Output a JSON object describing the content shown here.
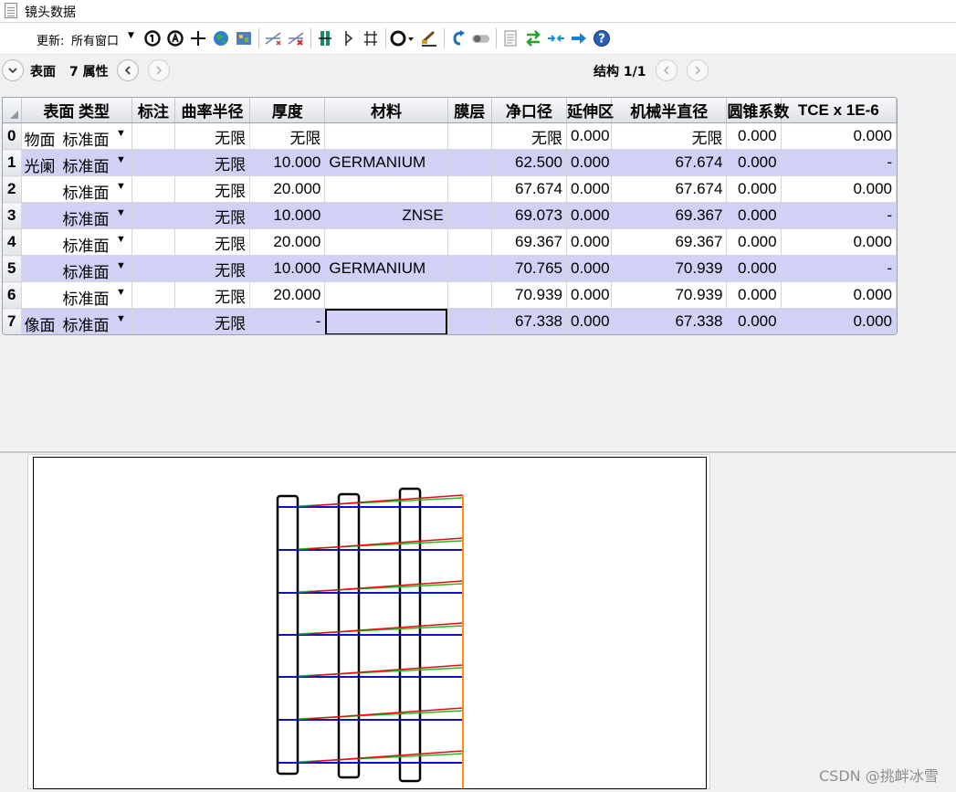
{
  "window": {
    "title": "镜头数据"
  },
  "toolbar": {
    "update_label": "更新:",
    "update_value": "所有窗口",
    "icons": [
      "refresh-all-icon",
      "refresh-icon",
      "crosshair-icon",
      "globe-icon",
      "map-icon",
      "add-fold-icon",
      "remove-fold-icon",
      "group-icon",
      "split-icon",
      "fold-icon",
      "circle-options-icon",
      "settings-brush-icon",
      "undo-arrow-icon",
      "toggle-icon",
      "page-icon",
      "swap-arrows-icon",
      "collapse-arrows-icon",
      "right-arrow-icon",
      "help-icon"
    ]
  },
  "nav": {
    "expand_icon": "chevron-down-icon",
    "left_label": "表面",
    "props_label": "7 属性",
    "config_label": "结构 1/1"
  },
  "grid": {
    "columns": [
      "表面 类型",
      "标注",
      "曲率半径",
      "厚度",
      "材料",
      "膜层",
      "净口径",
      "延伸区",
      "机械半直径",
      "圆锥系数",
      "TCE x 1E-6"
    ],
    "rows": [
      {
        "num": "0",
        "name": "物面",
        "type": "标准面",
        "radius": "无限",
        "thickness": "无限",
        "material": "",
        "clear": "无限",
        "ext": "0.000",
        "mech": "无限",
        "conic": "0.000",
        "tce": "0.000"
      },
      {
        "num": "1",
        "name": "光阑",
        "type": "标准面",
        "radius": "无限",
        "thickness": "10.000",
        "material": "GERMANIUM",
        "clear": "62.500",
        "ext": "0.000",
        "mech": "67.674",
        "conic": "0.000",
        "tce": "-"
      },
      {
        "num": "2",
        "name": "",
        "type": "标准面",
        "radius": "无限",
        "thickness": "20.000",
        "material": "",
        "clear": "67.674",
        "ext": "0.000",
        "mech": "67.674",
        "conic": "0.000",
        "tce": "0.000"
      },
      {
        "num": "3",
        "name": "",
        "type": "标准面",
        "radius": "无限",
        "thickness": "10.000",
        "material": "ZNSE",
        "clear": "69.073",
        "ext": "0.000",
        "mech": "69.367",
        "conic": "0.000",
        "tce": "-"
      },
      {
        "num": "4",
        "name": "",
        "type": "标准面",
        "radius": "无限",
        "thickness": "20.000",
        "material": "",
        "clear": "69.367",
        "ext": "0.000",
        "mech": "69.367",
        "conic": "0.000",
        "tce": "0.000"
      },
      {
        "num": "5",
        "name": "",
        "type": "标准面",
        "radius": "无限",
        "thickness": "10.000",
        "material": "GERMANIUM",
        "clear": "70.765",
        "ext": "0.000",
        "mech": "70.939",
        "conic": "0.000",
        "tce": "-"
      },
      {
        "num": "6",
        "name": "",
        "type": "标准面",
        "radius": "无限",
        "thickness": "20.000",
        "material": "",
        "clear": "70.939",
        "ext": "0.000",
        "mech": "70.939",
        "conic": "0.000",
        "tce": "0.000"
      },
      {
        "num": "7",
        "name": "像面",
        "type": "标准面",
        "radius": "无限",
        "thickness": "-",
        "material": "",
        "clear": "67.338",
        "ext": "0.000",
        "mech": "67.338",
        "conic": "0.000",
        "tce": "0.000"
      }
    ]
  },
  "layout_view": {
    "ray_colors": {
      "blue": "#1010c8",
      "green": "#22bb22",
      "red": "#e01010",
      "image": "#ff8c1a"
    }
  },
  "watermark": "CSDN @挑衅冰雪"
}
